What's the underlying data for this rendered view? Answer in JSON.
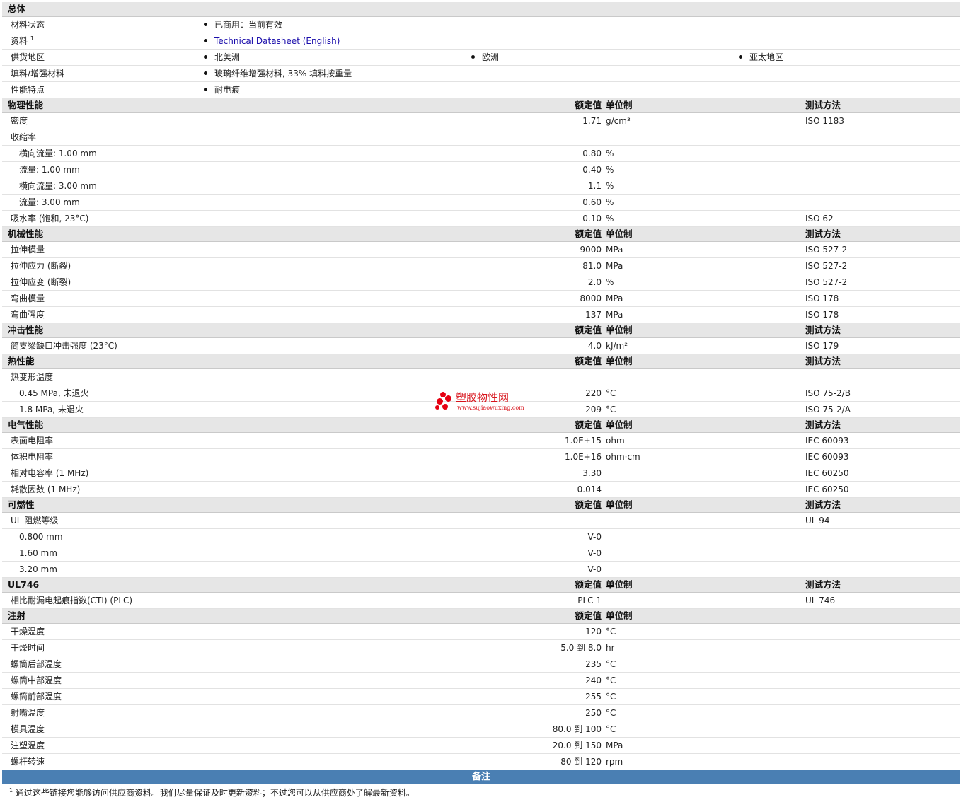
{
  "col_headers": {
    "value": "额定值",
    "unit": "单位制",
    "test": "测试方法"
  },
  "general": {
    "title": "总体",
    "rows": [
      {
        "label": "材料状态",
        "items": [
          "已商用：当前有效"
        ]
      },
      {
        "label": "资料",
        "sup": "1",
        "items": [],
        "link": "Technical Datasheet (English)"
      },
      {
        "label": "供货地区",
        "items": [
          "北美洲",
          "欧洲",
          "亚太地区"
        ]
      },
      {
        "label": "填料/增强材料",
        "items": [
          "玻璃纤维增强材料, 33% 填料按重量"
        ]
      },
      {
        "label": "性能特点",
        "items": [
          "耐电痕"
        ]
      }
    ]
  },
  "sections": [
    {
      "title": "物理性能",
      "show_test": true,
      "rows": [
        {
          "label": "密度",
          "value": "1.71",
          "unit": "g/cm³",
          "test": "ISO 1183"
        },
        {
          "label": "收缩率",
          "value": "",
          "unit": "",
          "test": ""
        },
        {
          "label": "横向流量: 1.00 mm",
          "sub": true,
          "value": "0.80",
          "unit": "%",
          "test": ""
        },
        {
          "label": "流量: 1.00 mm",
          "sub": true,
          "value": "0.40",
          "unit": "%",
          "test": ""
        },
        {
          "label": "横向流量: 3.00 mm",
          "sub": true,
          "value": "1.1",
          "unit": "%",
          "test": ""
        },
        {
          "label": "流量: 3.00 mm",
          "sub": true,
          "value": "0.60",
          "unit": "%",
          "test": ""
        },
        {
          "label": "吸水率 (饱和, 23°C)",
          "value": "0.10",
          "unit": "%",
          "test": "ISO 62"
        }
      ]
    },
    {
      "title": "机械性能",
      "show_test": true,
      "rows": [
        {
          "label": "拉伸模量",
          "value": "9000",
          "unit": "MPa",
          "test": "ISO 527-2"
        },
        {
          "label": "拉伸应力 (断裂)",
          "value": "81.0",
          "unit": "MPa",
          "test": "ISO 527-2"
        },
        {
          "label": "拉伸应变 (断裂)",
          "value": "2.0",
          "unit": "%",
          "test": "ISO 527-2"
        },
        {
          "label": "弯曲模量",
          "value": "8000",
          "unit": "MPa",
          "test": "ISO 178"
        },
        {
          "label": "弯曲强度",
          "value": "137",
          "unit": "MPa",
          "test": "ISO 178"
        }
      ]
    },
    {
      "title": "冲击性能",
      "show_test": true,
      "rows": [
        {
          "label": "简支梁缺口冲击强度 (23°C)",
          "value": "4.0",
          "unit": "kJ/m²",
          "test": "ISO 179"
        }
      ]
    },
    {
      "title": "热性能",
      "show_test": true,
      "rows": [
        {
          "label": "热变形温度",
          "value": "",
          "unit": "",
          "test": ""
        },
        {
          "label": "0.45 MPa, 未退火",
          "sub": true,
          "value": "220",
          "unit": "°C",
          "test": "ISO 75-2/B"
        },
        {
          "label": "1.8 MPa, 未退火",
          "sub": true,
          "value": "209",
          "unit": "°C",
          "test": "ISO 75-2/A"
        }
      ]
    },
    {
      "title": "电气性能",
      "show_test": true,
      "rows": [
        {
          "label": "表面电阻率",
          "value": "1.0E+15",
          "unit": "ohm",
          "test": "IEC 60093"
        },
        {
          "label": "体积电阻率",
          "value": "1.0E+16",
          "unit": "ohm·cm",
          "test": "IEC 60093"
        },
        {
          "label": "相对电容率 (1 MHz)",
          "value": "3.30",
          "unit": "",
          "test": "IEC 60250"
        },
        {
          "label": "耗散因数 (1 MHz)",
          "value": "0.014",
          "unit": "",
          "test": "IEC 60250"
        }
      ]
    },
    {
      "title": "可燃性",
      "show_test": true,
      "rows": [
        {
          "label": "UL 阻燃等级",
          "value": "",
          "unit": "",
          "test": "UL 94"
        },
        {
          "label": "0.800 mm",
          "sub": true,
          "value": "V-0",
          "unit": "",
          "test": ""
        },
        {
          "label": "1.60 mm",
          "sub": true,
          "value": "V-0",
          "unit": "",
          "test": ""
        },
        {
          "label": "3.20 mm",
          "sub": true,
          "value": "V-0",
          "unit": "",
          "test": ""
        }
      ]
    },
    {
      "title": "UL746",
      "show_test": true,
      "rows": [
        {
          "label": "相比耐漏电起痕指数(CTI) (PLC)",
          "value": "PLC 1",
          "unit": "",
          "test": "UL 746"
        }
      ]
    },
    {
      "title": "注射",
      "show_test": false,
      "rows": [
        {
          "label": "干燥温度",
          "value": "120",
          "unit": "°C",
          "test": ""
        },
        {
          "label": "干燥时间",
          "value": "5.0 到  8.0",
          "unit": "hr",
          "test": ""
        },
        {
          "label": "螺筒后部温度",
          "value": "235",
          "unit": "°C",
          "test": ""
        },
        {
          "label": "螺筒中部温度",
          "value": "240",
          "unit": "°C",
          "test": ""
        },
        {
          "label": "螺筒前部温度",
          "value": "255",
          "unit": "°C",
          "test": ""
        },
        {
          "label": "射嘴温度",
          "value": "250",
          "unit": "°C",
          "test": ""
        },
        {
          "label": "模具温度",
          "value": "80.0 到  100",
          "unit": "°C",
          "test": ""
        },
        {
          "label": "注塑温度",
          "value": "20.0 到  150",
          "unit": "MPa",
          "test": ""
        },
        {
          "label": "螺杆转速",
          "value": "80 到  120",
          "unit": "rpm",
          "test": ""
        }
      ]
    }
  ],
  "notes": {
    "title": "备注",
    "footnote_mark": "1",
    "footnote": "通过这些链接您能够访问供应商资料。我们尽量保证及时更新资料；不过您可以从供应商处了解最新资料。"
  },
  "watermark": {
    "name": "塑胶物性网",
    "url": "www.sujiaowuxing.com",
    "color": "#e60012"
  }
}
